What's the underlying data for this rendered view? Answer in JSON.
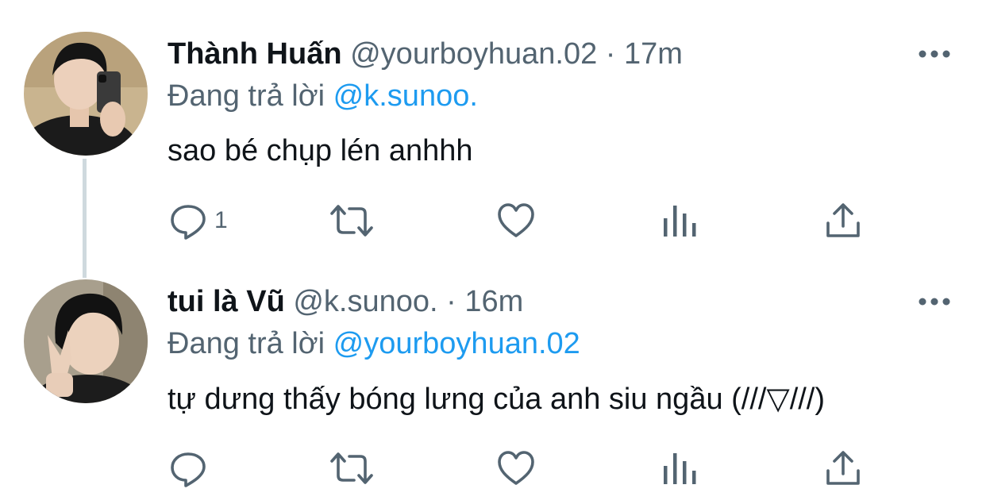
{
  "colors": {
    "text": "#0f1419",
    "secondary": "#536471",
    "accent": "#1d9bf0",
    "thread_line": "#cfd9de"
  },
  "tweets": [
    {
      "display_name": "Thành Huấn",
      "handle": "@yourboyhuan.02",
      "separator": "·",
      "time": "17m",
      "replying_prefix": "Đang trả lời",
      "replying_to": "@k.sunoo.",
      "text": "sao bé chụp lén anhhh",
      "reply_count": "1",
      "icons": [
        "reply-icon",
        "retweet-icon",
        "like-icon",
        "views-icon",
        "share-icon",
        "more-icon"
      ]
    },
    {
      "display_name": "tui là Vũ",
      "handle": "@k.sunoo.",
      "separator": "·",
      "time": "16m",
      "replying_prefix": "Đang trả lời",
      "replying_to": "@yourboyhuan.02",
      "text": "tự dưng thấy bóng lưng của anh siu ngầu (///▽///)",
      "reply_count": "",
      "icons": [
        "reply-icon",
        "retweet-icon",
        "like-icon",
        "views-icon",
        "share-icon",
        "more-icon"
      ]
    }
  ]
}
